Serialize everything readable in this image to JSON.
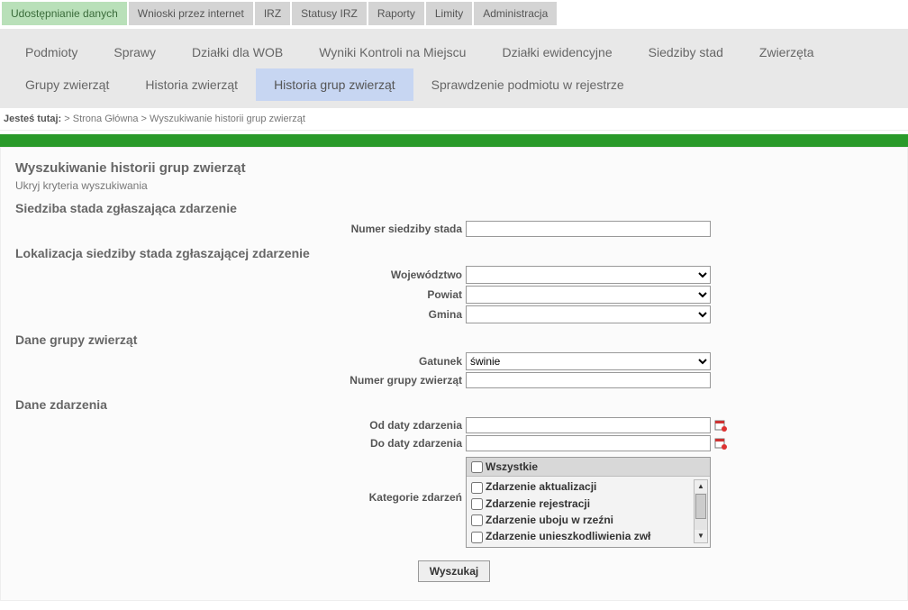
{
  "top_tabs": [
    {
      "label": "Udostępnianie danych",
      "active": true
    },
    {
      "label": "Wnioski przez internet"
    },
    {
      "label": "IRZ"
    },
    {
      "label": "Statusy IRZ"
    },
    {
      "label": "Raporty"
    },
    {
      "label": "Limity"
    },
    {
      "label": "Administracja"
    }
  ],
  "nav": [
    {
      "label": "Podmioty"
    },
    {
      "label": "Sprawy"
    },
    {
      "label": "Działki dla WOB"
    },
    {
      "label": "Wyniki Kontroli na Miejscu"
    },
    {
      "label": "Działki ewidencyjne"
    },
    {
      "label": "Siedziby stad"
    },
    {
      "label": "Zwierzęta"
    },
    {
      "label": "Grupy zwierząt"
    },
    {
      "label": "Historia zwierząt"
    },
    {
      "label": "Historia grup zwierząt",
      "active": true
    },
    {
      "label": "Sprawdzenie podmiotu w rejestrze"
    }
  ],
  "breadcrumb": {
    "prefix": "Jesteś tutaj:",
    "path": " > Strona Główna > Wyszukiwanie historii grup zwierząt"
  },
  "page": {
    "title": "Wyszukiwanie historii grup zwierząt",
    "hide_link": "Ukryj kryteria wyszukiwania",
    "sections": {
      "siedziba": {
        "title": "Siedziba stada zgłaszająca zdarzenie",
        "numer_label": "Numer siedziby stada"
      },
      "lokalizacja": {
        "title": "Lokalizacja siedziby stada zgłaszającej zdarzenie",
        "woj_label": "Województwo",
        "powiat_label": "Powiat",
        "gmina_label": "Gmina"
      },
      "dane_grupy": {
        "title": "Dane grupy zwierząt",
        "gatunek_label": "Gatunek",
        "gatunek_value": "świnie",
        "numer_label": "Numer grupy zwierząt"
      },
      "dane_zdarzenia": {
        "title": "Dane zdarzenia",
        "od_label": "Od daty zdarzenia",
        "do_label": "Do daty zdarzenia",
        "kategorie_label": "Kategorie zdarzeń",
        "kat_all": "Wszystkie",
        "kat_items": [
          "Zdarzenie aktualizacji",
          "Zdarzenie rejestracji",
          "Zdarzenie uboju w rzeźni",
          "Zdarzenie unieszkodliwienia zwł"
        ]
      }
    },
    "submit_label": "Wyszukaj"
  }
}
